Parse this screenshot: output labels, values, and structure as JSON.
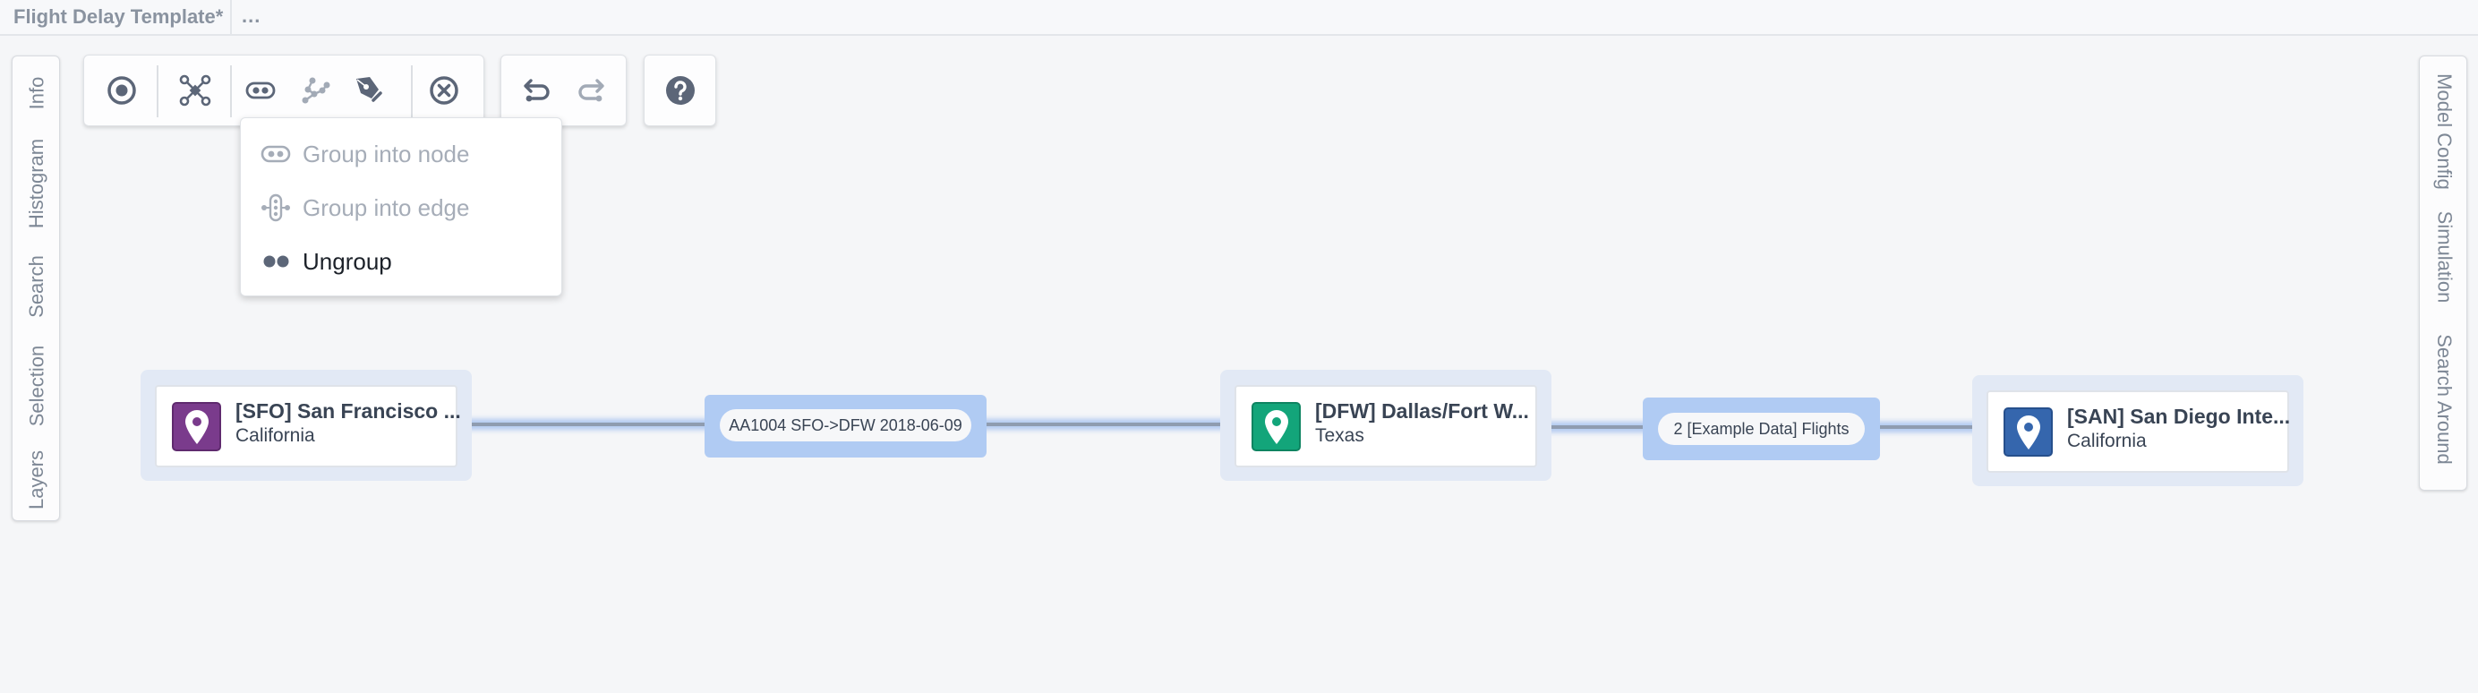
{
  "titlebar": {
    "title": "Flight Delay Template*",
    "more": "..."
  },
  "left_panel": {
    "tabs": [
      "Info",
      "Histogram",
      "Search",
      "Selection",
      "Layers"
    ]
  },
  "right_panel": {
    "tabs": [
      "Model Config",
      "Simulation",
      "Search Around"
    ]
  },
  "toolbar": {
    "tools": [
      {
        "icon": "target-icon",
        "state": "enabled"
      },
      {
        "icon": "layout-network-icon",
        "state": "enabled"
      },
      {
        "icon": "group-node-icon",
        "state": "enabled"
      },
      {
        "icon": "graph-path-icon",
        "state": "disabled"
      },
      {
        "icon": "pen-annotate-icon",
        "state": "enabled"
      },
      {
        "icon": "remove-circle-icon",
        "state": "enabled"
      }
    ],
    "history": [
      {
        "icon": "undo-icon",
        "state": "enabled"
      },
      {
        "icon": "redo-icon",
        "state": "disabled"
      }
    ],
    "help": {
      "icon": "help-icon"
    }
  },
  "group_menu": {
    "items": [
      {
        "label": "Group into node",
        "icon": "group-node-icon",
        "state": "disabled"
      },
      {
        "label": "Group into edge",
        "icon": "group-edge-icon",
        "state": "disabled"
      },
      {
        "label": "Ungroup",
        "icon": "ungroup-icon",
        "state": "enabled"
      }
    ]
  },
  "graph": {
    "nodes": [
      {
        "id": "sfo",
        "title": "[SFO] San Francisco ...",
        "subtitle": "California",
        "icon": "map-marker-icon",
        "color": "#7a3b8c"
      },
      {
        "id": "dfw",
        "title": "[DFW] Dallas/Fort W...",
        "subtitle": "Texas",
        "icon": "map-marker-icon",
        "color": "#13a57a"
      },
      {
        "id": "san",
        "title": "[SAN] San Diego Inte...",
        "subtitle": "California",
        "icon": "map-marker-icon",
        "color": "#3566ad"
      }
    ],
    "edges": [
      {
        "from": "sfo",
        "to": "dfw",
        "label": "AA1004 SFO->DFW 2018-06-09"
      },
      {
        "from": "dfw",
        "to": "san",
        "label": "2 [Example Data] Flights"
      }
    ],
    "colors": {
      "edge_label_bg": "#b0cbf3",
      "node_halo": "#e2e9f5",
      "edge_line": "#8f9cb0"
    }
  }
}
